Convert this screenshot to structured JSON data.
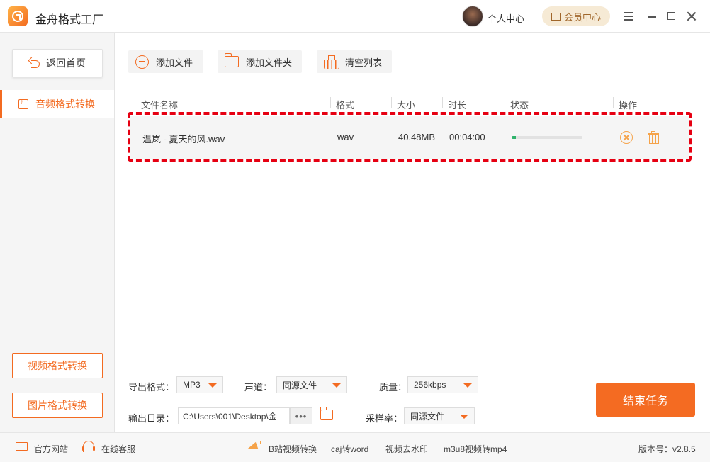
{
  "app": {
    "title": "金舟格式工厂",
    "user_center": "个人中心",
    "vip_center": "会员中心"
  },
  "sidebar": {
    "back_label": "返回首页",
    "active_item": "音频格式转换",
    "video_button": "视频格式转换",
    "image_button": "图片格式转换"
  },
  "toolbar": {
    "add_file": "添加文件",
    "add_folder": "添加文件夹",
    "clear_list": "清空列表"
  },
  "table": {
    "headers": [
      "文件名称",
      "格式",
      "大小",
      "时长",
      "状态",
      "操作"
    ],
    "rows": [
      {
        "name": "温岚 - 夏天的风.wav",
        "format": "wav",
        "size": "40.48MB",
        "duration": "00:04:00",
        "progress_percent": 6
      }
    ]
  },
  "settings": {
    "output_format_label": "导出格式：",
    "output_format_value": "MP3",
    "channel_label": "声道：",
    "channel_value": "同源文件",
    "quality_label": "质量：",
    "quality_value": "256kbps",
    "output_dir_label": "输出目录：",
    "output_dir_value": "C:\\Users\\001\\Desktop\\金",
    "browse_label": "•••",
    "sample_rate_label": "采样率：",
    "sample_rate_value": "同源文件",
    "end_task": "结束任务"
  },
  "statusbar": {
    "website": "官方网站",
    "support": "在线客服",
    "links": [
      "B站视频转换",
      "caj转word",
      "视频去水印",
      "m3u8视频转mp4"
    ],
    "version": "版本号：v2.8.5"
  },
  "colors": {
    "accent": "#f36b21",
    "highlight_border": "#e60012",
    "progress": "#2fb36b",
    "vip_bg": "#f6ead5"
  }
}
